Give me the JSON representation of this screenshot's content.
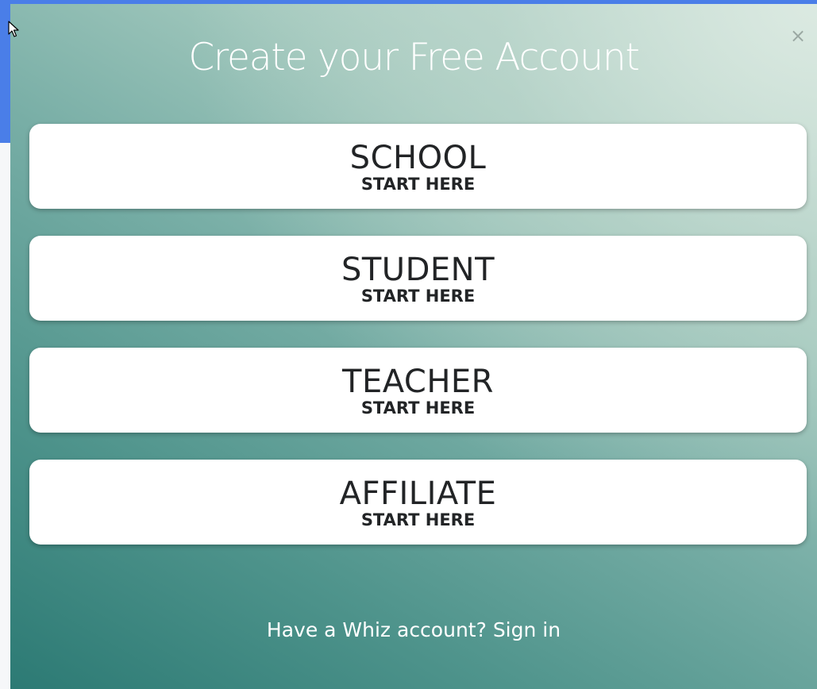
{
  "modal": {
    "title": "Create your Free Account",
    "close_label": "×",
    "options": [
      {
        "title": "SCHOOL",
        "subtitle": "START HERE"
      },
      {
        "title": "STUDENT",
        "subtitle": "START HERE"
      },
      {
        "title": "TEACHER",
        "subtitle": "START HERE"
      },
      {
        "title": "AFFILIATE",
        "subtitle": "START HERE"
      }
    ],
    "footer": {
      "prompt": "Have a Whiz account?",
      "link": "Sign in"
    }
  },
  "colors": {
    "background_bar": "#4a7ee8",
    "modal_dark": "#2c7a74",
    "modal_light": "#cfe3d9",
    "card": "#ffffff",
    "card_text": "#222426"
  },
  "icons": {
    "close": "close-icon",
    "cursor": "mouse-pointer-icon"
  }
}
